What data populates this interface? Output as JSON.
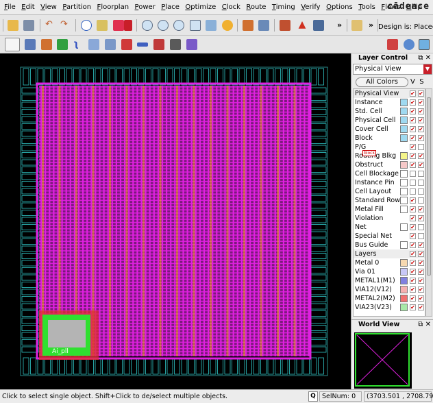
{
  "menubar": {
    "items": [
      "File",
      "Edit",
      "View",
      "Partition",
      "Floorplan",
      "Power",
      "Place",
      "Optimize",
      "Clock",
      "Route",
      "Timing",
      "Verify",
      "Options",
      "Tools",
      "Flows",
      "Help"
    ],
    "logo": "cādence"
  },
  "toolbar": {
    "overflow_label": "»",
    "design_status": "Design is: Placed",
    "icons": [
      "open-icon",
      "save-icon",
      "undo-icon",
      "redo-icon",
      "info-icon",
      "highlight-icon",
      "color-icon",
      "zoom-in-icon",
      "zoom-out-icon",
      "zoom-area-icon",
      "zoom-fit-icon",
      "zoom-prev-icon",
      "redraw-icon",
      "move-icon",
      "dim-icon",
      "hierarchy-icon",
      "warning-icon",
      "window-icon",
      "script-icon"
    ],
    "tools": [
      "select-tool-icon",
      "move-tool-icon",
      "cut-tool-icon",
      "add-tool-icon",
      "wire-tool-icon",
      "stretch-tool-icon",
      "split-tool-icon",
      "merge-tool-icon",
      "ruler-tool-icon",
      "pin-tool-icon",
      "edit-tool-icon",
      "route-tool-icon",
      "layers-toggle-icon",
      "flow-icon",
      "palette-icon"
    ]
  },
  "canvas": {
    "label": "Ai_pll"
  },
  "layer_control": {
    "title": "Layer Control",
    "view_select": "Physical View",
    "all_colors_label": "All Colors",
    "v_label": "V",
    "s_label": "S",
    "block_tooltip": "block",
    "rows": [
      {
        "label": "Physical View",
        "type": "head",
        "v": true,
        "s": true
      },
      {
        "label": "Instance",
        "color": "#9fd9f0",
        "v": true,
        "s": true
      },
      {
        "label": "Std. Cell",
        "color": "#9fd9f0",
        "v": true,
        "s": true
      },
      {
        "label": "Physical Cell",
        "color": "#9fd9f0",
        "v": true,
        "s": true
      },
      {
        "label": "Cover Cell",
        "color": "#9fd9f0",
        "v": true,
        "s": true
      },
      {
        "label": "Block",
        "color": "#9fd9f0",
        "v": true,
        "s": true
      },
      {
        "label": "P/G",
        "v": true,
        "s": false
      },
      {
        "label": "Routing Blkg",
        "color": "#f5f58a",
        "v": true,
        "s": true
      },
      {
        "label": "Obstruct",
        "color": "#f6c8c8",
        "v": true,
        "s": true
      },
      {
        "label": "Cell Blockage",
        "color": "#ffffff",
        "v": false,
        "s": false
      },
      {
        "label": "Instance Pin",
        "color": "#ffffff",
        "v": false,
        "s": false
      },
      {
        "label": "Cell Layout",
        "color": "#ffffff",
        "v": false,
        "s": false
      },
      {
        "label": "Standard Row",
        "color": "#ffffff",
        "v": true,
        "s": false
      },
      {
        "label": "Metal Fill",
        "color": "#ffffff",
        "v": true,
        "s": true
      },
      {
        "label": "Violation",
        "v": true,
        "s": true
      },
      {
        "label": "Net",
        "color": "#ffffff",
        "v": true,
        "s": false
      },
      {
        "label": "Special Net",
        "v": true,
        "s": false
      },
      {
        "label": "Bus Guide",
        "color": "#ffffff",
        "v": true,
        "s": true
      },
      {
        "label": "Layers",
        "type": "head",
        "v": true,
        "s": true
      },
      {
        "label": "Metal 0",
        "color": "#f6d8b0",
        "v": true,
        "s": true
      },
      {
        "label": "Via 01",
        "color": "#c8c8f6",
        "v": true,
        "s": true
      },
      {
        "label": "METAL1(M1)",
        "color": "#8080e0",
        "v": true,
        "s": true
      },
      {
        "label": "VIA12(V12)",
        "color": "#f6b0b0",
        "v": true,
        "s": true
      },
      {
        "label": "METAL2(M2)",
        "color": "#f07070",
        "v": true,
        "s": true
      },
      {
        "label": "VIA23(V23)",
        "color": "#a8e8a8",
        "v": true,
        "s": true
      }
    ]
  },
  "world_view": {
    "title": "World View"
  },
  "status": {
    "message": "Click to select single object. Shift+Click to de/select multiple objects.",
    "q_label": "Q",
    "selnum": "SelNum: 0",
    "coords": "(3703.501 , 2708.798)"
  },
  "colors": {
    "metal_magenta": "#e020e0",
    "metal_orange": "#f0a020",
    "pad_cyan": "#30c8c8",
    "pll_gray": "#b4b4b4",
    "pll_green": "#30e030",
    "pll_red": "#e03030"
  }
}
